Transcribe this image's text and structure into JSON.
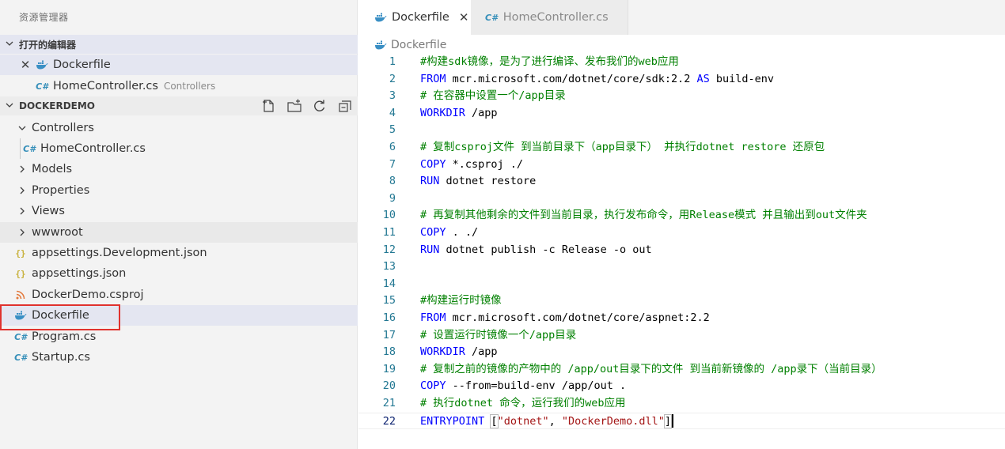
{
  "sidebar": {
    "title": "资源管理器",
    "open_editors": {
      "header": "打开的编辑器",
      "items": [
        {
          "label": "Dockerfile",
          "icon": "docker-icon"
        },
        {
          "label": "HomeController.cs",
          "folder": "Controllers",
          "icon": "csharp-icon"
        }
      ]
    },
    "project": {
      "header": "DOCKERDEMO",
      "actions": [
        "new-file-icon",
        "new-folder-icon",
        "refresh-icon",
        "collapse-all-icon"
      ],
      "tree": [
        {
          "label": "Controllers",
          "type": "folder-open"
        },
        {
          "label": "HomeController.cs",
          "type": "cs"
        },
        {
          "label": "Models",
          "type": "folder"
        },
        {
          "label": "Properties",
          "type": "folder"
        },
        {
          "label": "Views",
          "type": "folder"
        },
        {
          "label": "wwwroot",
          "type": "folder"
        },
        {
          "label": "appsettings.Development.json",
          "type": "json"
        },
        {
          "label": "appsettings.json",
          "type": "json"
        },
        {
          "label": "DockerDemo.csproj",
          "type": "rss"
        },
        {
          "label": "Dockerfile",
          "type": "docker"
        },
        {
          "label": "Program.cs",
          "type": "cs"
        },
        {
          "label": "Startup.cs",
          "type": "cs"
        }
      ]
    }
  },
  "editor": {
    "tabs": [
      {
        "label": "Dockerfile",
        "active": true,
        "icon": "docker-icon"
      },
      {
        "label": "HomeController.cs",
        "active": false,
        "icon": "csharp-icon"
      }
    ],
    "breadcrumb": "Dockerfile",
    "lines": [
      {
        "n": "1",
        "parts": [
          [
            "cm",
            "#构建sdk镜像，是为了进行编译、发布我们的web应用"
          ]
        ]
      },
      {
        "n": "2",
        "parts": [
          [
            "kw",
            "FROM"
          ],
          [
            "",
            " mcr.microsoft.com/dotnet/core/sdk:2.2 "
          ],
          [
            "kw",
            "AS"
          ],
          [
            "",
            " build-env"
          ]
        ]
      },
      {
        "n": "3",
        "parts": [
          [
            "cm",
            "# 在容器中设置一个/app目录"
          ]
        ]
      },
      {
        "n": "4",
        "parts": [
          [
            "kw",
            "WORKDIR"
          ],
          [
            "",
            " /app"
          ]
        ]
      },
      {
        "n": "5",
        "parts": []
      },
      {
        "n": "6",
        "parts": [
          [
            "cm",
            "# 复制csproj文件 到当前目录下（app目录下） 并执行dotnet restore 还原包"
          ]
        ]
      },
      {
        "n": "7",
        "parts": [
          [
            "kw",
            "COPY"
          ],
          [
            "",
            " *.csproj ./"
          ]
        ]
      },
      {
        "n": "8",
        "parts": [
          [
            "kw",
            "RUN"
          ],
          [
            "",
            " dotnet restore"
          ]
        ]
      },
      {
        "n": "9",
        "parts": []
      },
      {
        "n": "10",
        "parts": [
          [
            "cm",
            "# 再复制其他剩余的文件到当前目录，执行发布命令，用Release模式 并且输出到out文件夹"
          ]
        ]
      },
      {
        "n": "11",
        "parts": [
          [
            "kw",
            "COPY"
          ],
          [
            "",
            " . ./"
          ]
        ]
      },
      {
        "n": "12",
        "parts": [
          [
            "kw",
            "RUN"
          ],
          [
            "",
            " dotnet publish -c Release -o out"
          ]
        ]
      },
      {
        "n": "13",
        "parts": []
      },
      {
        "n": "14",
        "parts": []
      },
      {
        "n": "15",
        "parts": [
          [
            "cm",
            "#构建运行时镜像"
          ]
        ]
      },
      {
        "n": "16",
        "parts": [
          [
            "kw",
            "FROM"
          ],
          [
            "",
            " mcr.microsoft.com/dotnet/core/aspnet:2.2"
          ]
        ]
      },
      {
        "n": "17",
        "parts": [
          [
            "cm",
            "# 设置运行时镜像一个/app目录"
          ]
        ]
      },
      {
        "n": "18",
        "parts": [
          [
            "kw",
            "WORKDIR"
          ],
          [
            "",
            " /app"
          ]
        ]
      },
      {
        "n": "19",
        "parts": [
          [
            "cm",
            "# 复制之前的镜像的产物中的 /app/out目录下的文件 到当前新镜像的 /app录下（当前目录）"
          ]
        ]
      },
      {
        "n": "20",
        "parts": [
          [
            "kw",
            "COPY"
          ],
          [
            "",
            " --from=build-env /app/out ."
          ]
        ]
      },
      {
        "n": "21",
        "parts": [
          [
            "cm",
            "# 执行dotnet 命令，运行我们的web应用"
          ]
        ]
      },
      {
        "n": "22",
        "parts": [
          [
            "kw",
            "ENTRYPOINT"
          ],
          [
            "",
            " "
          ],
          [
            "br",
            "["
          ],
          [
            "st",
            "\"dotnet\""
          ],
          [
            "",
            ", "
          ],
          [
            "st",
            "\"DockerDemo.dll\""
          ],
          [
            "br",
            "]"
          ]
        ],
        "current": true
      }
    ]
  },
  "colors": {
    "keyword": "#0000ff",
    "comment": "#008000",
    "string": "#a31515",
    "line_number": "#237893",
    "selection": "#e4e6f1",
    "annotation_box": "#e0322e"
  }
}
